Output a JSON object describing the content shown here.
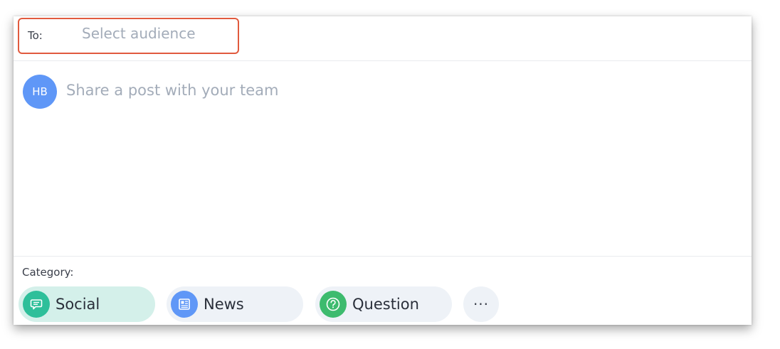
{
  "to": {
    "label": "To:",
    "placeholder": "Select audience",
    "highlight_color": "#e15a3e"
  },
  "composer": {
    "avatar_initials": "HB",
    "avatar_color": "#5f97f7",
    "placeholder": "Share a post with your team"
  },
  "category": {
    "label": "Category:",
    "selected": "Social",
    "items": [
      {
        "label": "Social",
        "icon": "speech-bubble-icon",
        "color": "#2ebf9a"
      },
      {
        "label": "News",
        "icon": "newspaper-icon",
        "color": "#5f97f7"
      },
      {
        "label": "Question",
        "icon": "question-mark-icon",
        "color": "#3dbb6e"
      }
    ],
    "more_label": "···"
  }
}
